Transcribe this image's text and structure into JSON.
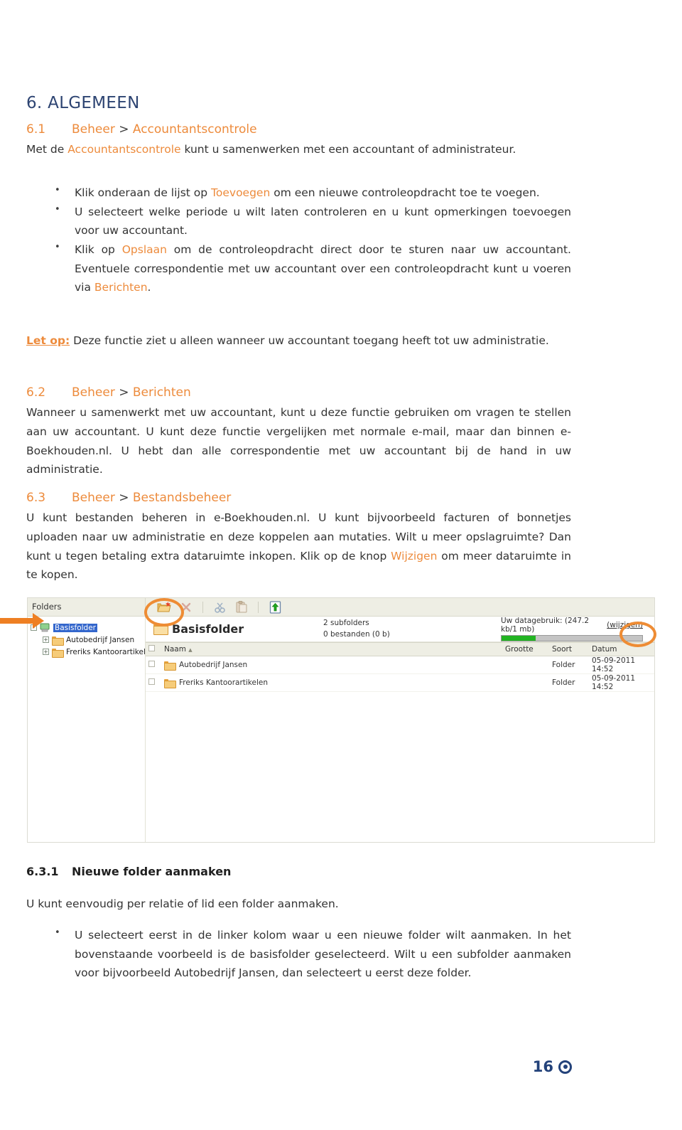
{
  "document": {
    "chapter_heading": "6. ALGEMEEN",
    "page_number": "16"
  },
  "section_61": {
    "number": "6.1",
    "title_part1": "Beheer",
    "separator": ">",
    "title_part2": "Accountantscontrole",
    "intro_a": "Met de ",
    "intro_link": "Accountantscontrole",
    "intro_b": " kunt u samenwerken met een accountant of administrateur.",
    "bullets": [
      {
        "a": "Klik onderaan de lijst op ",
        "link": "Toevoegen",
        "b": " om een nieuwe controleopdracht toe te voegen."
      },
      {
        "a": "U selecteert welke periode u wilt laten controleren en u kunt opmerkingen toevoegen voor uw accountant.",
        "link": "",
        "b": ""
      },
      {
        "a": "Klik op ",
        "link": "Opslaan",
        "b": " om de controleopdracht direct door te sturen naar uw accountant. Eventuele correspondentie met uw accountant over een controleopdracht kunt u voeren via ",
        "link2": "Berichten",
        "c": "."
      }
    ],
    "note_label": "Let op:",
    "note_text": " Deze functie ziet u alleen wanneer uw accountant toegang heeft tot uw administratie."
  },
  "section_62": {
    "number": "6.2",
    "title_part1": "Beheer",
    "separator": ">",
    "title_part2": "Berichten",
    "body": "Wanneer u samenwerkt met uw accountant, kunt u deze functie gebruiken om vragen te stellen aan uw accountant. U kunt deze functie vergelijken met normale e-mail, maar dan binnen e-Boekhouden.nl. U hebt dan alle correspondentie met uw accountant bij de hand in uw administratie."
  },
  "section_63": {
    "number": "6.3",
    "title_part1": "Beheer",
    "separator": ">",
    "title_part2": "Bestandsbeheer",
    "body_a": "U kunt bestanden beheren in e-Boekhouden.nl. U kunt bijvoorbeeld facturen of bonnetjes uploaden naar uw administratie en deze koppelen aan mutaties. Wilt u meer opslagruimte? Dan kunt u tegen betaling extra dataruimte inkopen. Klik op de knop ",
    "body_link": "Wijzigen",
    "body_b": " om meer dataruimte in te kopen."
  },
  "section_631": {
    "number": "6.3.1",
    "title": "Nieuwe folder aanmaken",
    "body": "U kunt eenvoudig per relatie of lid een folder aanmaken.",
    "bullet": "U selecteert eerst in de linker kolom waar u een nieuwe folder wilt aanmaken. In het bovenstaande voorbeeld is de basisfolder geselecteerd. Wilt u een subfolder aanmaken voor bijvoorbeeld Autobedrijf Jansen, dan selecteert u eerst deze folder."
  },
  "screenshot": {
    "folders_label": "Folders",
    "toolbar": [
      {
        "name": "new-folder-icon",
        "label": "Nieuwe folder"
      },
      {
        "name": "delete-icon",
        "label": "Verwijderen"
      },
      {
        "name": "cut-scissors-icon",
        "label": "Knippen"
      },
      {
        "name": "paste-clipboard-icon",
        "label": "Plakken"
      },
      {
        "name": "upload-icon",
        "label": "Uploaden"
      }
    ],
    "tree": [
      {
        "label": "Basisfolder",
        "level": 1,
        "selected": true,
        "expander": "-"
      },
      {
        "label": "Autobedrijf Jansen",
        "level": 2,
        "selected": false,
        "expander": "+"
      },
      {
        "label": "Freriks Kantoorartikelen",
        "level": 2,
        "selected": false,
        "expander": "+"
      }
    ],
    "current_folder": "Basisfolder",
    "subfolders_count": "2 subfolders",
    "files_count": "0 bestanden (0 b)",
    "usage_label": "Uw datagebruik: (247.2 kb/1 mb)",
    "usage_link": "(wijzigen)",
    "usage_percent": 24,
    "columns": [
      "Naam",
      "Grootte",
      "Soort",
      "Datum"
    ],
    "sort_indicator": "▲",
    "rows": [
      {
        "name": "Autobedrijf Jansen",
        "size": "",
        "kind": "Folder",
        "date": "05-09-2011 14:52"
      },
      {
        "name": "Freriks Kantoorartikelen",
        "size": "",
        "kind": "Folder",
        "date": "05-09-2011 14:52"
      }
    ]
  },
  "colors": {
    "accent_orange": "#ed8b3c",
    "heading_navy": "#2d4472",
    "annotation_orange": "#ee8c34",
    "usage_green": "#22b422",
    "selection_blue": "#3366cc"
  }
}
